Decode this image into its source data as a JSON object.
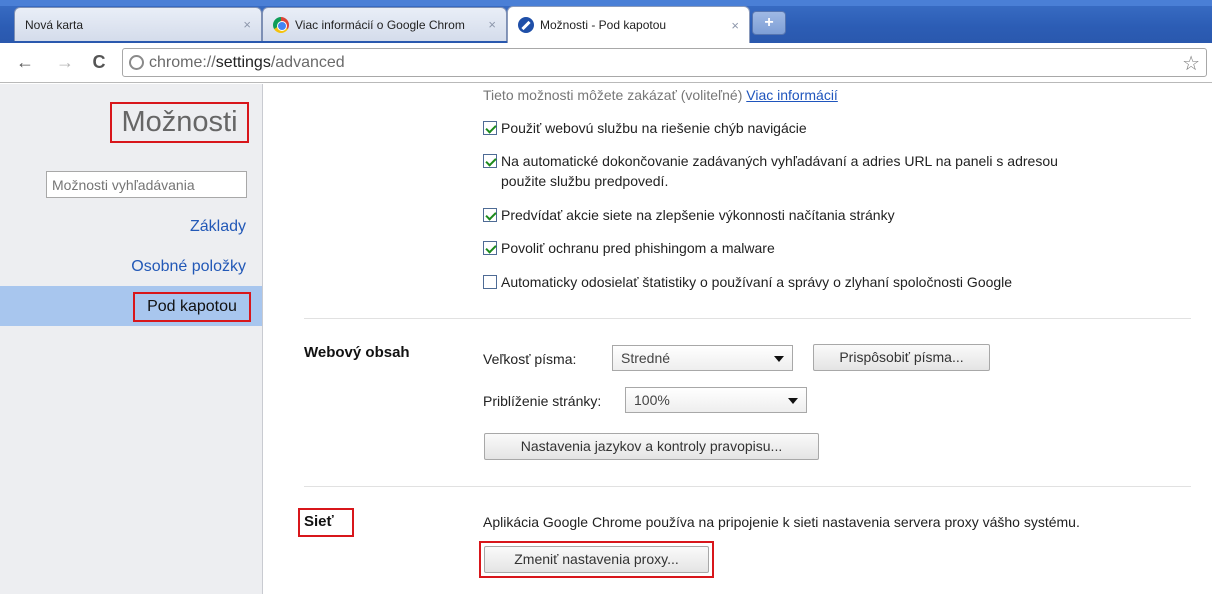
{
  "tabs": [
    {
      "title": "Nová karta",
      "close": "×",
      "icon": "none",
      "active": false
    },
    {
      "title": "Viac informácií o Google Chrom",
      "close": "×",
      "icon": "chrome-logo-icon",
      "active": false
    },
    {
      "title": "Možnosti - Pod kapotou",
      "close": "×",
      "icon": "wrench-icon",
      "active": true
    }
  ],
  "new_tab_label": "+",
  "toolbar": {
    "back": "←",
    "forward": "→",
    "reload": "C",
    "url_prefix": "chrome://",
    "url_bold": "settings",
    "url_suffix": "/advanced",
    "star": "☆"
  },
  "sidebar": {
    "title": "Možnosti",
    "search_placeholder": "Možnosti vyhľadávania",
    "items": [
      {
        "label": "Základy"
      },
      {
        "label": "Osobné položky"
      },
      {
        "label": "Pod kapotou"
      }
    ]
  },
  "privacy": {
    "info_text": "Tieto možnosti môžete zakázať (voliteľné)",
    "info_link": "Viac informácií",
    "options": [
      {
        "label": "Použiť webovú službu na riešenie chýb navigácie",
        "checked": true
      },
      {
        "label": "Na automatické dokončovanie zadávaných vyhľadávaní a adries URL na paneli s adresou",
        "label_line2": "použite službu predpovedí.",
        "checked": true
      },
      {
        "label": "Predvídať akcie siete na zlepšenie výkonnosti načítania stránky",
        "checked": true
      },
      {
        "label": "Povoliť ochranu pred phishingom a malware",
        "checked": true
      },
      {
        "label": "Automaticky odosielať štatistiky o používaní a správy o zlyhaní spoločnosti Google",
        "checked": false
      }
    ]
  },
  "web_content": {
    "title": "Webový obsah",
    "font_size_label": "Veľkosť písma:",
    "font_size_value": "Stredné",
    "customize_fonts_button": "Prispôsobiť písma...",
    "zoom_label": "Priblíženie stránky:",
    "zoom_value": "100%",
    "languages_button": "Nastavenia jazykov a kontroly pravopisu..."
  },
  "network": {
    "title": "Sieť",
    "description": "Aplikácia Google Chrome používa na pripojenie k sieti nastavenia servera proxy vášho systému.",
    "proxy_button": "Zmeniť nastavenia proxy..."
  },
  "colors": {
    "highlight_outline": "#d8161b",
    "sidebar_active": "#a8c6ee",
    "link": "#2258b7"
  }
}
